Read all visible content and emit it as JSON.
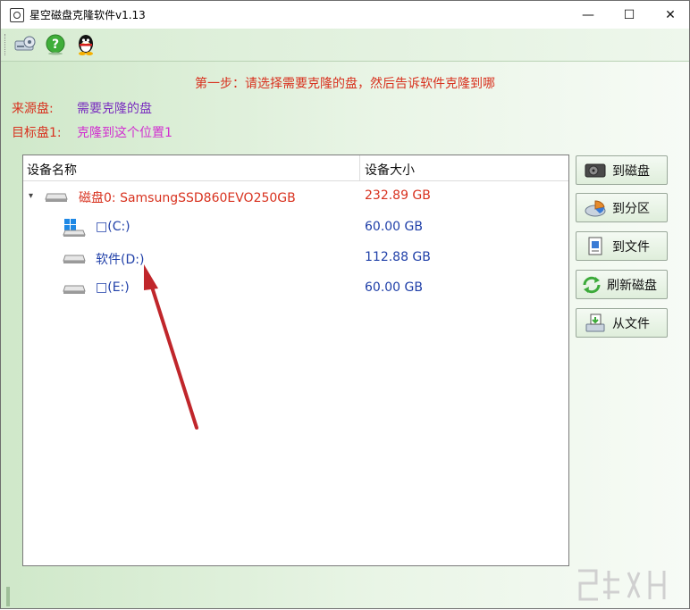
{
  "window": {
    "title": "星空磁盘克隆软件v1.13",
    "controls": {
      "minimize": "—",
      "maximize": "☐",
      "close": "✕"
    }
  },
  "toolbar": {
    "icons": [
      "settings-drive-icon",
      "help-icon",
      "qq-penguin-icon"
    ]
  },
  "instruction": "第一步：请选择需要克隆的盘，然后告诉软件克隆到哪",
  "source": {
    "label": "来源盘:",
    "value": "需要克隆的盘"
  },
  "target": {
    "label": "目标盘1:",
    "value": "克隆到这个位置1"
  },
  "table": {
    "columns": [
      "设备名称",
      "设备大小"
    ],
    "rows": [
      {
        "name": "磁盘0: SamsungSSD860EVO250GB",
        "size": "232.89 GB",
        "color": "#d8321f",
        "level": 0
      },
      {
        "name": "□(C:)",
        "size": "60.00 GB",
        "color": "#1f3fa8",
        "level": 1
      },
      {
        "name": "软件(D:)",
        "size": "112.88 GB",
        "color": "#1f3fa8",
        "level": 1
      },
      {
        "name": "□(E:)",
        "size": "60.00 GB",
        "color": "#1f3fa8",
        "level": 1
      }
    ]
  },
  "buttons": {
    "to_disk": "到磁盘",
    "to_partition": "到分区",
    "to_file": "到文件",
    "refresh_disk": "刷新磁盘",
    "from_file": "从文件"
  },
  "colors": {
    "label_red": "#d8321f",
    "source_value": "#7a2fbf",
    "target_value": "#d12fd0",
    "annotation_arrow": "#c0262b"
  }
}
